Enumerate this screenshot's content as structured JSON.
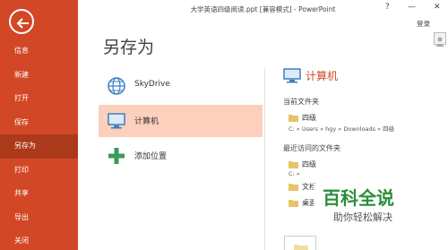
{
  "window": {
    "title": "大学英语四级阅读.ppt [兼容模式] - PowerPoint",
    "help": "?",
    "minimize": "—",
    "close": "✕",
    "login": "登录"
  },
  "sidebar": {
    "items": [
      {
        "label": "信息"
      },
      {
        "label": "新建"
      },
      {
        "label": "打开"
      },
      {
        "label": "保存"
      },
      {
        "label": "另存为"
      },
      {
        "label": "打印"
      },
      {
        "label": "共享"
      },
      {
        "label": "导出"
      },
      {
        "label": "关闭"
      }
    ],
    "accent_color": "#d24726"
  },
  "main": {
    "heading": "另存为",
    "locations": [
      {
        "label": "SkyDrive",
        "icon": "globe-icon"
      },
      {
        "label": "计算机",
        "icon": "computer-icon"
      },
      {
        "label": "添加位置",
        "icon": "plus-icon"
      }
    ]
  },
  "panel": {
    "title": "计算机",
    "current_folder_label": "当前文件夹",
    "current_folder": {
      "name": "四级",
      "path": "C: » Users » hgy » Downloads » 四级"
    },
    "recent_label": "最近访问的文件夹",
    "recent": [
      {
        "name": "四级",
        "path": "C: » "
      },
      {
        "name": "文档"
      },
      {
        "name": "桌面"
      }
    ]
  },
  "watermark": {
    "title": "百科全说",
    "subtitle": "助你轻松解决"
  }
}
